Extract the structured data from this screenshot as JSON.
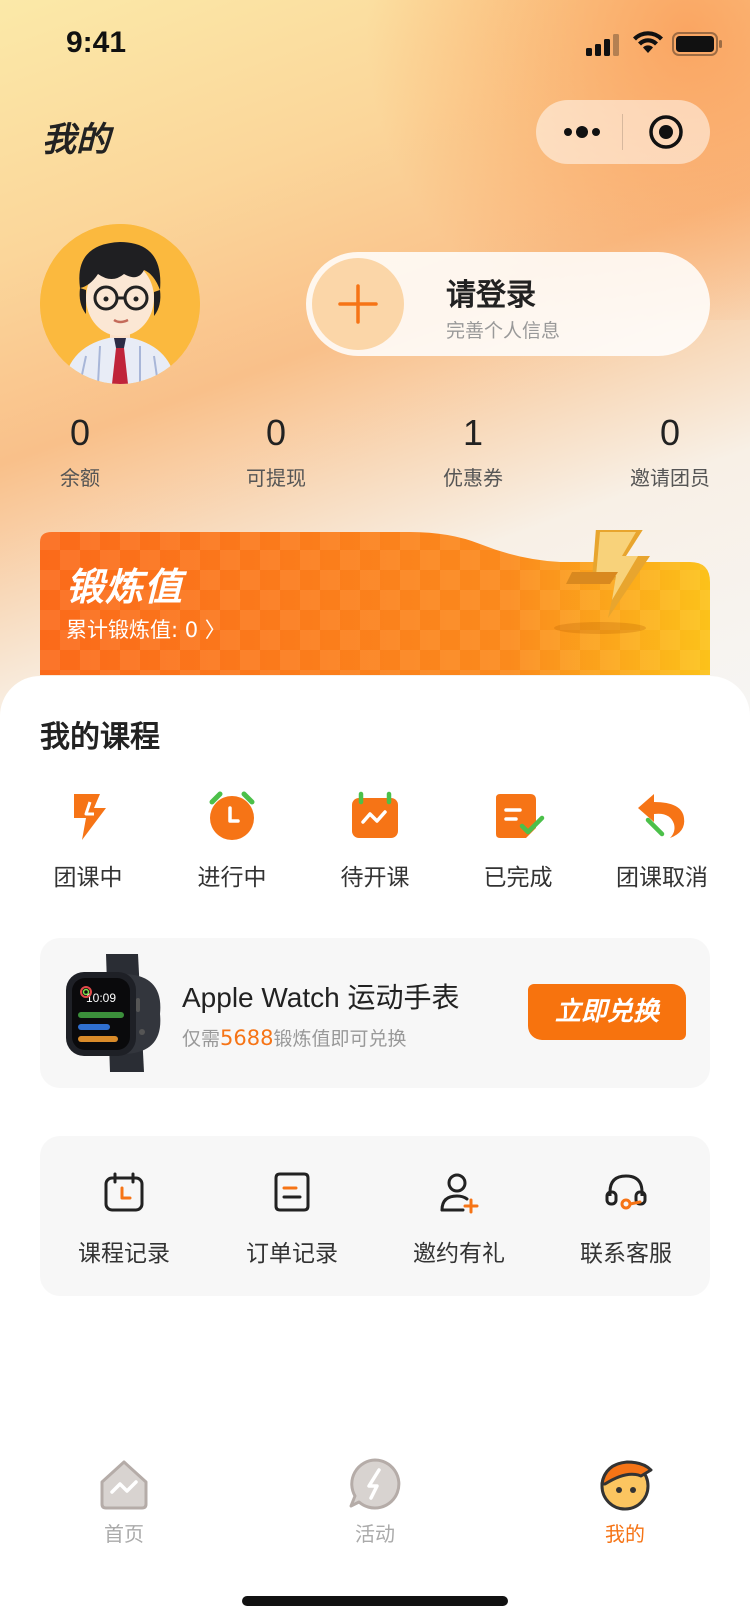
{
  "status_bar": {
    "time": "9:41"
  },
  "nav": {
    "title": "我的"
  },
  "profile": {
    "login_title": "请登录",
    "login_subtitle": "完善个人信息"
  },
  "stats": [
    {
      "value": "0",
      "label": "余额"
    },
    {
      "value": "0",
      "label": "可提现"
    },
    {
      "value": "1",
      "label": "优惠券"
    },
    {
      "value": "0",
      "label": "邀请团员"
    }
  ],
  "banner": {
    "title": "锻炼值",
    "subtitle": "累计锻炼值: 0 〉"
  },
  "courses": {
    "title": "我的课程",
    "items": [
      {
        "label": "团课中",
        "icon": "lightning-icon"
      },
      {
        "label": "进行中",
        "icon": "alarm-clock-icon"
      },
      {
        "label": "待开课",
        "icon": "calendar-icon"
      },
      {
        "label": "已完成",
        "icon": "document-check-icon"
      },
      {
        "label": "团课取消",
        "icon": "undo-arrow-icon"
      }
    ]
  },
  "promo": {
    "title": "Apple Watch 运动手表",
    "sub_prefix": "仅需",
    "sub_value": "5688",
    "sub_suffix": "锻炼值即可兑换",
    "button": "立即兑换"
  },
  "tools": [
    {
      "label": "课程记录",
      "icon": "calendar-outline-icon"
    },
    {
      "label": "订单记录",
      "icon": "order-icon"
    },
    {
      "label": "邀约有礼",
      "icon": "add-user-icon"
    },
    {
      "label": "联系客服",
      "icon": "headset-icon"
    }
  ],
  "tabbar": [
    {
      "label": "首页",
      "icon": "home-icon",
      "active": false
    },
    {
      "label": "活动",
      "icon": "activity-icon",
      "active": false
    },
    {
      "label": "我的",
      "icon": "mine-icon",
      "active": true
    }
  ],
  "colors": {
    "accent": "#f67416",
    "banner": "#fb7d19"
  }
}
